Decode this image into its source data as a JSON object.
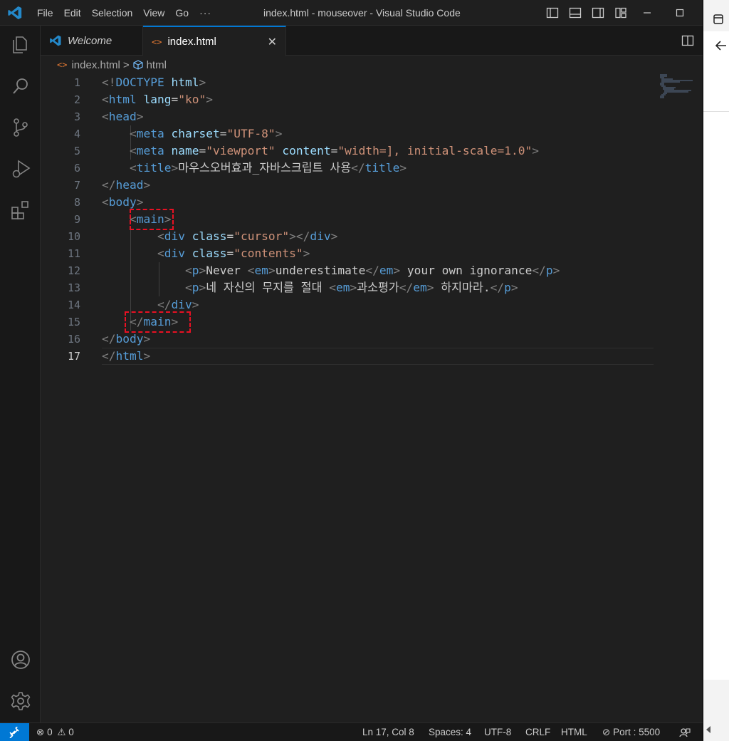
{
  "titlebar": {
    "menu": [
      "File",
      "Edit",
      "Selection",
      "View",
      "Go",
      "···"
    ],
    "window_title": "index.html - mouseover - Visual Studio Code"
  },
  "tabs": [
    {
      "label": "Welcome",
      "icon": "vscode-logo-icon"
    },
    {
      "label": "index.html",
      "icon": "html-file-icon",
      "close": "✕"
    }
  ],
  "breadcrumb": {
    "file": "index.html",
    "separator": ">",
    "symbol": "html"
  },
  "editor": {
    "lines": [
      "1",
      "2",
      "3",
      "4",
      "5",
      "6",
      "7",
      "8",
      "9",
      "10",
      "11",
      "12",
      "13",
      "14",
      "15",
      "16",
      "17"
    ],
    "current_line": "17"
  },
  "statusbar": {
    "errors": "0",
    "warnings": "0",
    "position": "Ln 17, Col 8",
    "spaces": "Spaces: 4",
    "encoding": "UTF-8",
    "eol": "CRLF",
    "language": "HTML",
    "port": "Port : 5500"
  },
  "colors": {
    "accent": "#0078d4",
    "tag": "#569cd6",
    "attribute": "#9cdcfe",
    "string": "#ce9178",
    "bracket": "#808080",
    "highlight_box": "#e81123"
  }
}
